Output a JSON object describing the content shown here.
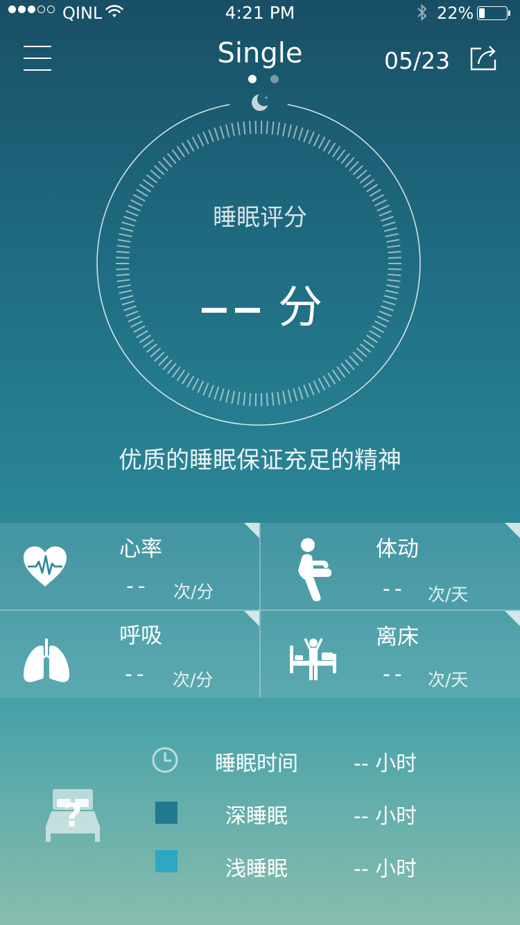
{
  "status_bar": {
    "carrier": "QINL",
    "time": "4:21 PM",
    "battery_percent": "22%",
    "battery_level": 0.22
  },
  "header": {
    "title": "Single",
    "date": "05/23",
    "page_count": 2,
    "active_page": 1
  },
  "score": {
    "label": "睡眠评分",
    "unit": "分"
  },
  "slogan": "优质的睡眠保证充足的精神",
  "metrics": [
    {
      "label": "心率",
      "value": "--",
      "unit": "次/分",
      "icon": "heart-rate-icon"
    },
    {
      "label": "体动",
      "value": "--",
      "unit": "次/天",
      "icon": "body-movement-icon"
    },
    {
      "label": "呼吸",
      "value": "--",
      "unit": "次/分",
      "icon": "lungs-icon"
    },
    {
      "label": "离床",
      "value": "--",
      "unit": "次/天",
      "icon": "leave-bed-icon"
    }
  ],
  "summary": {
    "rows": [
      {
        "label": "睡眠时间",
        "value": "--  小时",
        "icon": "clock-icon"
      },
      {
        "label": "深睡眠",
        "value": "--  小时",
        "color": "#22788f"
      },
      {
        "label": "浅睡眠",
        "value": "--  小时",
        "color": "#2da7c2"
      }
    ]
  },
  "colors": {
    "deep_sleep": "#22788f",
    "light_sleep": "#2da7c2",
    "background_top": "#184f66",
    "background_bottom": "#88bdae"
  }
}
